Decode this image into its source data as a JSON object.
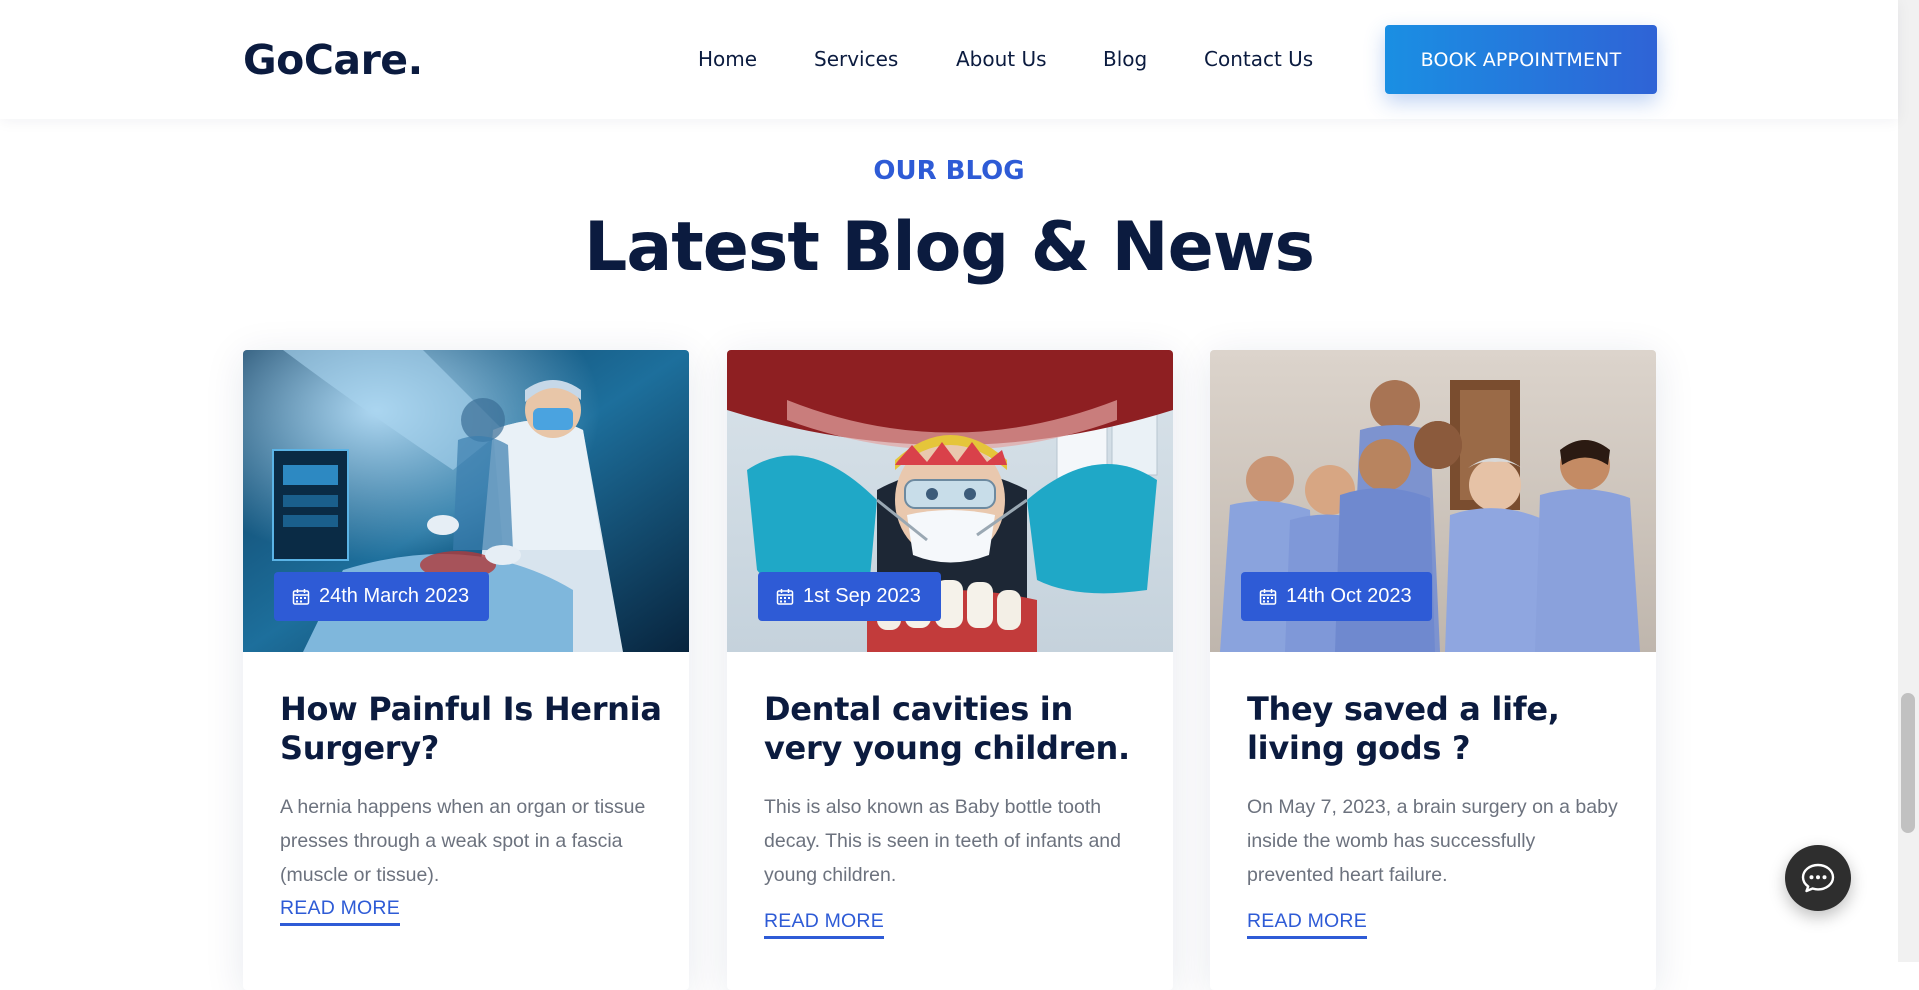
{
  "header": {
    "logo": "GoCare.",
    "nav": [
      {
        "label": "Home"
      },
      {
        "label": "Services"
      },
      {
        "label": "About Us"
      },
      {
        "label": "Blog"
      },
      {
        "label": "Contact Us"
      }
    ],
    "cta_label": "BOOK APPOINTMENT"
  },
  "section": {
    "eyebrow": "OUR BLOG",
    "title": "Latest Blog & News"
  },
  "posts": [
    {
      "date": "24th March 2023",
      "title": "How Painful Is Hernia Surgery?",
      "excerpt": "A hernia happens when an organ or tissue presses through a weak spot in a fascia (muscle or tissue).",
      "link_label": "READ MORE",
      "image": "surgeons-operating-photo"
    },
    {
      "date": "1st Sep 2023",
      "title": "Dental cavities in very young children.",
      "excerpt": "This is also known as Baby bottle tooth decay. This is seen in teeth of infants and young children.",
      "link_label": "READ MORE",
      "image": "dentist-examining-photo"
    },
    {
      "date": "14th Oct 2023",
      "title": "They saved a life, living gods ?",
      "excerpt": "On May 7, 2023, a brain surgery on a baby inside the womb has successfully prevented heart failure.",
      "link_label": "READ MORE",
      "image": "medical-team-group-photo"
    }
  ],
  "colors": {
    "brand_dark": "#0b1b3f",
    "accent": "#2e5bd6",
    "cta_gradient_start": "#1a8fe3",
    "body_text": "#6c727e"
  },
  "icons": {
    "calendar": "calendar-icon",
    "chat": "chat-bubble-icon"
  }
}
